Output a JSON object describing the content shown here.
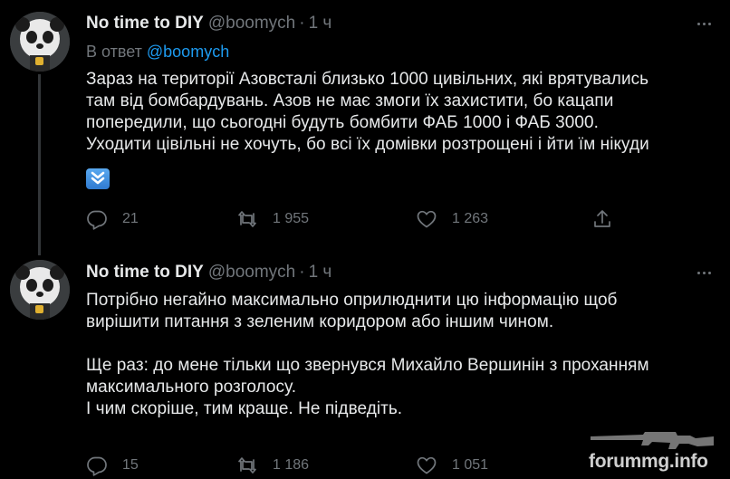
{
  "tweets": [
    {
      "name": "No time to DIY",
      "handle": "@boomych",
      "separator": "·",
      "time": "1 ч",
      "reply_prefix": "В ответ",
      "reply_handle": "@boomych",
      "text": "Зараз на території Азовсталі близько 1000 цивільних, які врятувались\nтам від бомбардувань. Азов не має змоги їх захистити, бо кацапи\nпопередили, що сьогодні будуть бомбити ФАБ 1000 і ФАБ 3000.\nУходити цівільні не хочуть, бо всі їх домівки розтрощені і йти їм нікуди",
      "emoji": "double-down-arrow-icon",
      "replies": "21",
      "retweets": "1 955",
      "likes": "1 263"
    },
    {
      "name": "No time to DIY",
      "handle": "@boomych",
      "separator": "·",
      "time": "1 ч",
      "text": "Потрібно негайно максимально оприлюднити цю інформацію щоб\nвирішити питання з зеленим коридором або іншим чином.\n\nЩе раз: до мене тільки що звернувся Михайло Вершинін з проханням\nмаксимального розголосу.\nІ чим скоріше, тим краще. Не підведіть.",
      "replies": "15",
      "retweets": "1 186",
      "likes": "1 051"
    }
  ],
  "watermark": {
    "text": "forummg.info"
  },
  "colors": {
    "background": "#000000",
    "text_primary": "#e7e9ea",
    "text_secondary": "#71767b",
    "link": "#1d9bf0",
    "thread_line": "#333639"
  }
}
